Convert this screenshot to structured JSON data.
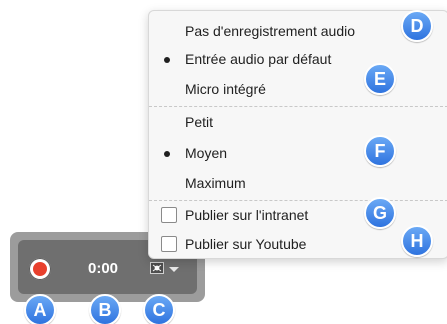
{
  "recorder": {
    "timer": "0:00"
  },
  "menu": {
    "audio_items": [
      {
        "label": "Pas d'enregistrement audio",
        "selected": false
      },
      {
        "label": "Entrée audio par défaut",
        "selected": true
      },
      {
        "label": "Micro intégré",
        "selected": false
      }
    ],
    "size_items": [
      {
        "label": "Petit",
        "selected": false
      },
      {
        "label": "Moyen",
        "selected": true
      },
      {
        "label": "Maximum",
        "selected": false
      }
    ],
    "checkbox_items": [
      {
        "label": "Publier sur l'intranet",
        "checked": false
      },
      {
        "label": "Publier sur Youtube",
        "checked": false
      }
    ]
  },
  "callouts": {
    "a": "A",
    "b": "B",
    "c": "C",
    "d": "D",
    "e": "E",
    "f": "F",
    "g": "G",
    "h": "H"
  },
  "colors": {
    "record_red": "#e8402d",
    "badge_blue": "#2f73df",
    "panel_gray": "#6f6f6f"
  }
}
